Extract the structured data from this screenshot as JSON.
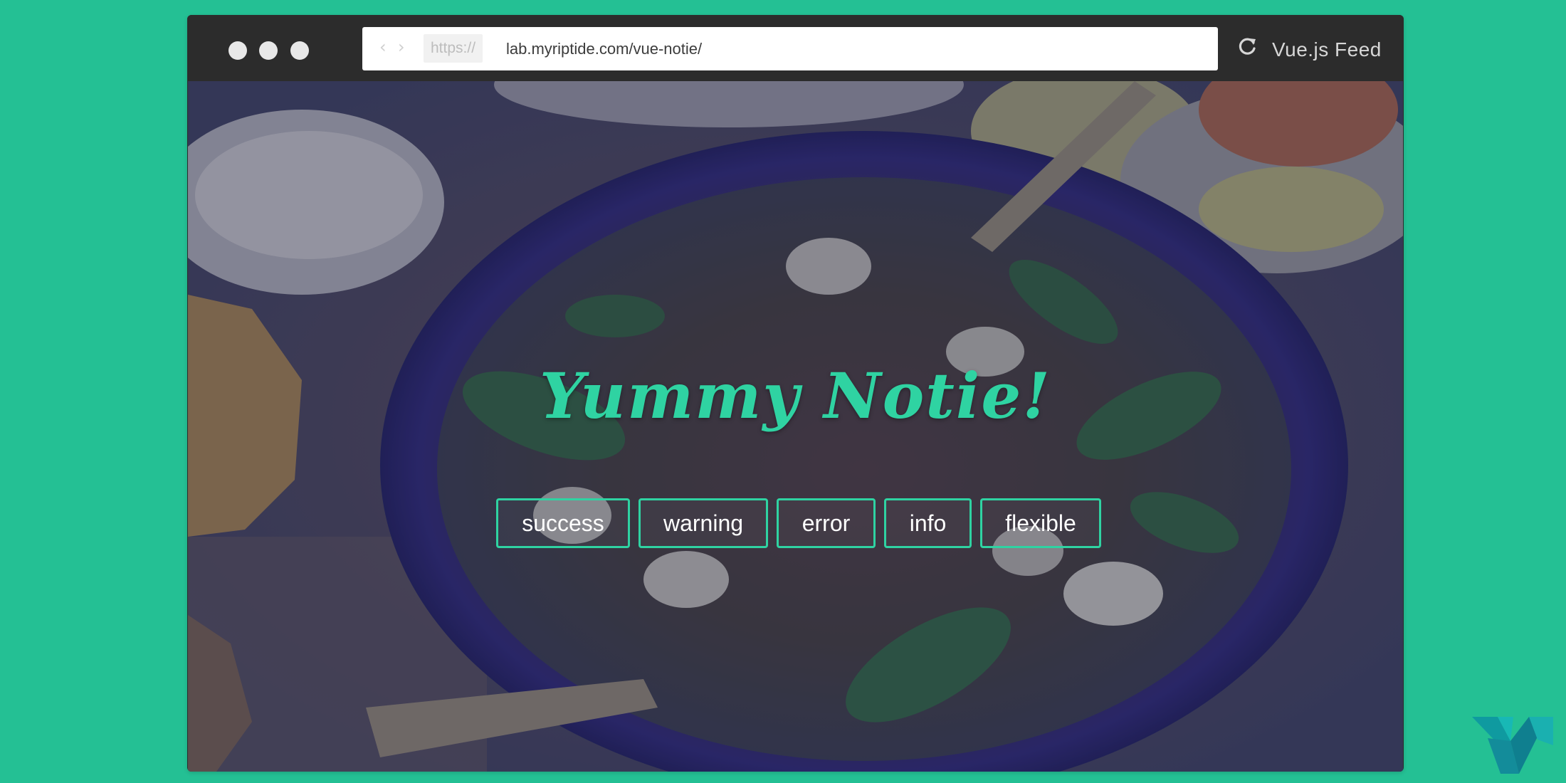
{
  "browser": {
    "url_scheme": "https://",
    "url": "lab.myriptide.com/vue-notie/",
    "feed_label": "Vue.js Feed",
    "nav_back_glyph": "‹",
    "nav_forward_glyph": "›"
  },
  "page": {
    "title": "Yummy Notie!",
    "buttons": [
      {
        "label": "success"
      },
      {
        "label": "warning"
      },
      {
        "label": "error"
      },
      {
        "label": "info"
      },
      {
        "label": "flexible"
      }
    ]
  },
  "colors": {
    "background": "#24c094",
    "accent": "#2fd3a2",
    "browser_chrome": "#2c2c2c"
  },
  "icons": [
    "reload-icon",
    "vue-logo-icon"
  ]
}
